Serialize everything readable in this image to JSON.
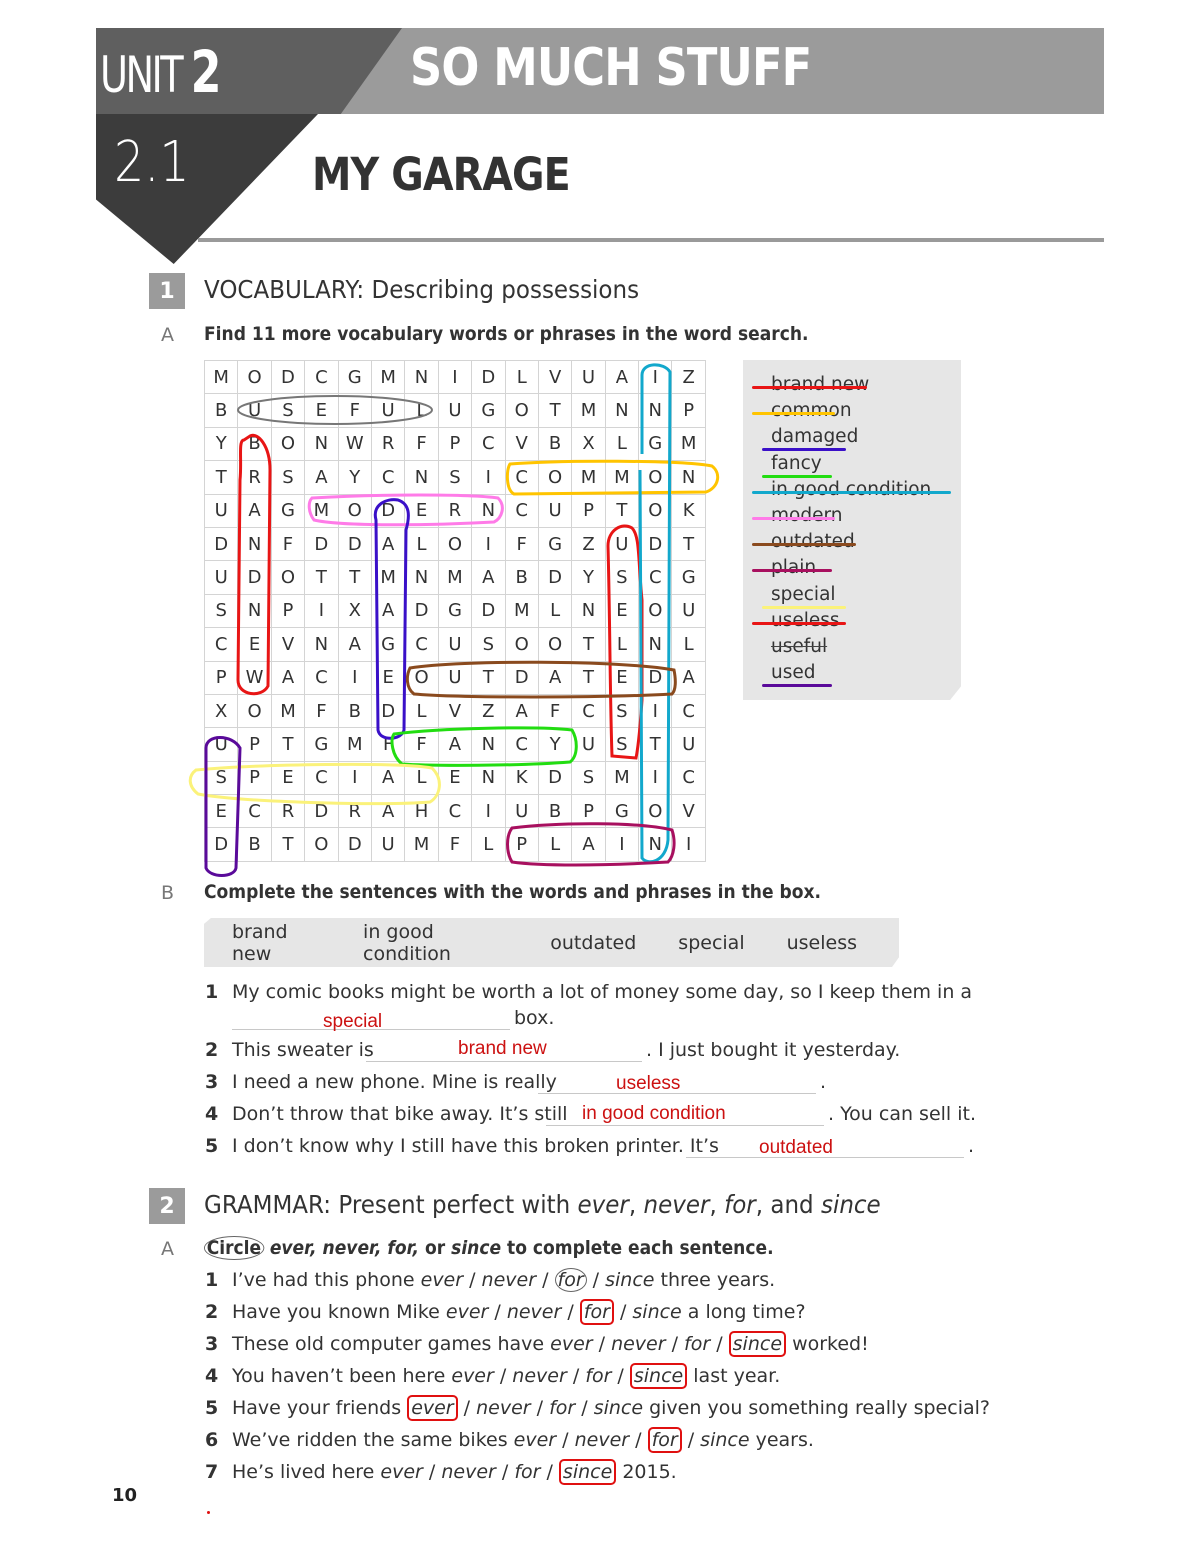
{
  "header": {
    "unit_word": "UNIT",
    "unit_number": "2",
    "unit_title": "SO MUCH STUFF",
    "lesson_number": "2.1",
    "lesson_title": "MY GARAGE"
  },
  "section1": {
    "number": "1",
    "title": "VOCABULARY: Describing possessions",
    "partA": {
      "letter": "A",
      "instruction": "Find 11 more vocabulary words or phrases in the word search."
    },
    "word_search": {
      "rows": [
        "MODCGMNIDLVUAIZ",
        "BUSEFULUGOTMNNP",
        "YBONWRFPCVBXLGM",
        "TRSAYCNSICOMMON",
        "UAGMODERNCUPTOK",
        "DNFDDALOIFGZUDT",
        "UDOTTMNMABDYSCG",
        "SNPIXADGDMLNEOU",
        "CEVNAGCUSOOTLNL",
        "PWACIEOUTDATEDA",
        "XOMFBDLVZAFCSIC",
        "UPTGMFFANCYUSTU",
        "SPECIALENKDSMIC",
        "ECRDRAHCIUBPGOV",
        "DBTODUMFLPLAINI"
      ],
      "found_words": [
        {
          "word": "useful",
          "color": "#666666"
        },
        {
          "word": "brand new",
          "color": "#e81515"
        },
        {
          "word": "common",
          "color": "#ffc400"
        },
        {
          "word": "modern",
          "color": "#ff7be8"
        },
        {
          "word": "damaged",
          "color": "#3a10c8"
        },
        {
          "word": "useless",
          "color": "#e81515"
        },
        {
          "word": "in good condition",
          "color": "#12a8cc"
        },
        {
          "word": "outdated",
          "color": "#8a4a1e"
        },
        {
          "word": "fancy",
          "color": "#22dd11"
        },
        {
          "word": "special",
          "color": "#fbf27a"
        },
        {
          "word": "used",
          "color": "#5a0a9a"
        },
        {
          "word": "plain",
          "color": "#a8105f"
        }
      ]
    },
    "word_list": [
      {
        "text": "brand new",
        "mark": "strike",
        "color": "#e81515"
      },
      {
        "text": "common",
        "mark": "strike",
        "color": "#ffc400"
      },
      {
        "text": "damaged",
        "mark": "underline",
        "color": "#3a10c8"
      },
      {
        "text": "fancy",
        "mark": "underline",
        "color": "#22dd11"
      },
      {
        "text": "in good condition",
        "mark": "strike",
        "color": "#12a8cc"
      },
      {
        "text": "modern",
        "mark": "strike",
        "color": "#ff7be8"
      },
      {
        "text": "outdated",
        "mark": "strike",
        "color": "#8a4a1e"
      },
      {
        "text": "plain",
        "mark": "strike",
        "color": "#a8105f"
      },
      {
        "text": "special",
        "mark": "underline",
        "color": "#fbf27a"
      },
      {
        "text": "useless",
        "mark": "strike",
        "color": "#e81515"
      },
      {
        "text": "useful",
        "mark": "printed-strike",
        "color": "#444444"
      },
      {
        "text": "used",
        "mark": "underline",
        "color": "#5a0a9a"
      }
    ],
    "partB": {
      "letter": "B",
      "instruction": "Complete the sentences with the words and phrases in the box.",
      "box_words": [
        "brand new",
        "in good condition",
        "outdated",
        "special",
        "useless"
      ],
      "sentences": [
        {
          "number": "1",
          "before": "My comic books might be worth a lot of money some day, so I keep them in a",
          "after": "box.",
          "answer": "special"
        },
        {
          "number": "2",
          "before": "This sweater is",
          "after": ". I just bought it yesterday.",
          "answer": "brand new"
        },
        {
          "number": "3",
          "before": "I need a new phone. Mine is really",
          "after": ".",
          "answer": "useless"
        },
        {
          "number": "4",
          "before": "Don’t throw that bike away. It’s still",
          "after": ". You can sell it.",
          "answer": "in good condition"
        },
        {
          "number": "5",
          "before": "I don’t know why I still have this broken printer. It’s",
          "after": ".",
          "answer": "outdated"
        }
      ]
    }
  },
  "section2": {
    "number": "2",
    "title_plain": "GRAMMAR: Present perfect with ",
    "title_words": [
      "ever",
      "never",
      "for",
      "since"
    ],
    "title_and": "and",
    "partA": {
      "letter": "A",
      "instruction_circle": "Circle",
      "instruction_italic": "ever, never, for,",
      "instruction_or": "or",
      "instruction_since": "since",
      "instruction_rest": "to complete each sentence.",
      "options_text": "ever / never / for / since",
      "sentences": [
        {
          "number": "1",
          "before": "I’ve had this phone",
          "after": "three years.",
          "circled": "for",
          "example": true
        },
        {
          "number": "2",
          "before": "Have you known Mike",
          "after": "a long time?",
          "circled": "for"
        },
        {
          "number": "3",
          "before": "These old computer games have",
          "after": "worked!",
          "circled": "since"
        },
        {
          "number": "4",
          "before": "You haven’t been here",
          "after": "last year.",
          "circled": "since"
        },
        {
          "number": "5",
          "before": "Have your friends",
          "after": "given you something really special?",
          "circled": "ever"
        },
        {
          "number": "6",
          "before": "We’ve ridden the same bikes",
          "after": "years.",
          "circled": "for"
        },
        {
          "number": "7",
          "before": "He’s lived here",
          "after": "2015.",
          "circled": "since"
        }
      ]
    }
  },
  "footer": {
    "page_number": "10"
  }
}
